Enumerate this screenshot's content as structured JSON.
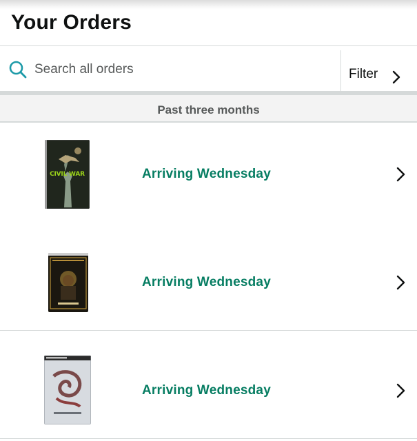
{
  "header": {
    "title": "Your Orders"
  },
  "search": {
    "placeholder": "Search all orders",
    "icon": "search-icon"
  },
  "filter": {
    "label": "Filter",
    "icon": "chevron-right-icon"
  },
  "section": {
    "label": "Past three months"
  },
  "orders": [
    {
      "status": "Arriving Wednesday",
      "cover_text": "CIVIL WAR"
    },
    {
      "status": "Arriving Wednesday"
    },
    {
      "status": "Arriving Wednesday"
    }
  ],
  "colors": {
    "accent": "#067d62",
    "search_icon": "#1c9aa8",
    "divider": "#d5d9d9",
    "muted_text": "#565959"
  }
}
